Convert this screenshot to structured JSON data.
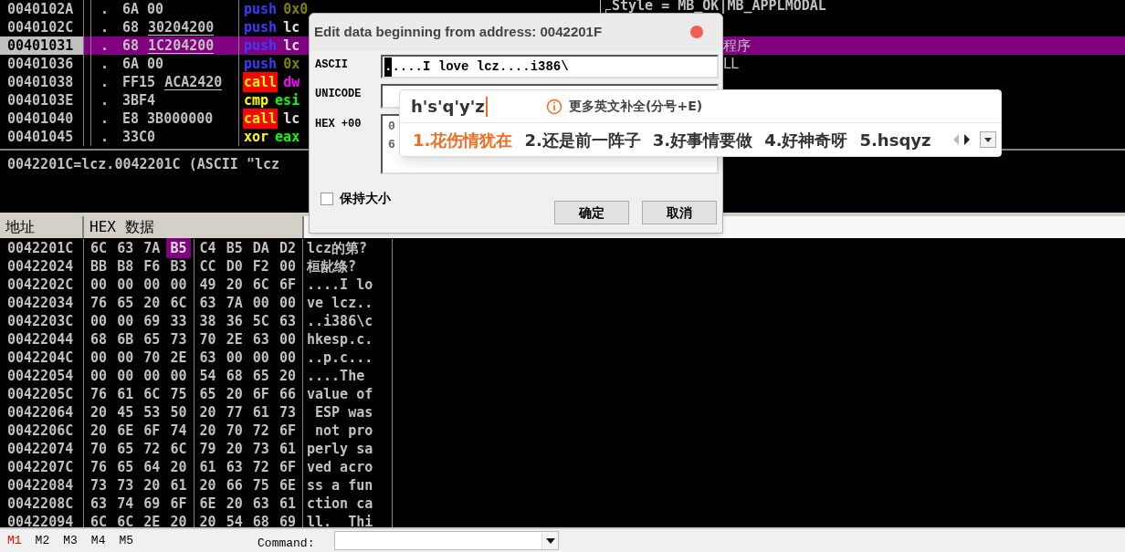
{
  "disassembly": {
    "rows": [
      {
        "address": "0040102A",
        "dot": ".",
        "hex": "6A 00",
        "mnemonic": {
          "text": "push",
          "kind": "push"
        },
        "operand": {
          "text": "0x0",
          "kind": "constant"
        },
        "selected": false,
        "comment": {
          "text": "Style = MB_OK|MB_APPLMODAL",
          "kind": "bracket"
        }
      },
      {
        "address": "0040102C",
        "dot": ".",
        "hex": "68",
        "fixup": "30204200",
        "mnemonic": {
          "text": "push",
          "kind": "push"
        },
        "operand": {
          "text": "lc",
          "kind": "symbol"
        },
        "selected": false
      },
      {
        "address": "00401031",
        "dot": ".",
        "hex": "68",
        "fixup": "1C204200",
        "mnemonic": {
          "text": "push",
          "kind": "push"
        },
        "operand": {
          "text": "lc",
          "kind": "symbol"
        },
        "selected": true,
        "comment": {
          "text": "程序",
          "kind": "plain"
        }
      },
      {
        "address": "00401036",
        "dot": ".",
        "hex": "6A 00",
        "mnemonic": {
          "text": "push",
          "kind": "push"
        },
        "operand": {
          "text": "0x",
          "kind": "constant"
        },
        "selected": false,
        "comment": {
          "text": "LL",
          "kind": "plain"
        }
      },
      {
        "address": "00401038",
        "dot": ".",
        "hex": "FF15",
        "fixup": "ACA2420",
        "mnemonic": {
          "text": "call",
          "kind": "call"
        },
        "operand": {
          "text": "dw",
          "kind": "memory"
        },
        "selected": false
      },
      {
        "address": "0040103E",
        "dot": ".",
        "hex": "3BF4",
        "mnemonic": {
          "text": "cmp",
          "kind": "arith"
        },
        "operand": {
          "text": "esi",
          "kind": "register"
        },
        "selected": false
      },
      {
        "address": "00401040",
        "dot": ".",
        "hex": "E8 3B000000",
        "mnemonic": {
          "text": "call",
          "kind": "call"
        },
        "operand": {
          "text": "lc",
          "kind": "symbol"
        },
        "selected": false
      },
      {
        "address": "00401045",
        "dot": ".",
        "hex": "33C0",
        "mnemonic": {
          "text": "xor",
          "kind": "arith"
        },
        "operand": {
          "text": "eax",
          "kind": "register"
        },
        "selected": false
      }
    ]
  },
  "info": "0042201C=lcz.0042201C (ASCII \"lcz",
  "dump": {
    "columns": [
      "地址",
      "HEX 数据"
    ],
    "rows": [
      {
        "address": "0042201C",
        "bytes": [
          {
            "value": "6C",
            "selected": false
          },
          {
            "value": "63",
            "selected": false
          },
          {
            "value": "7A",
            "selected": false
          },
          {
            "value": "B5",
            "selected": true
          },
          {
            "value": "C4",
            "selected": false
          },
          {
            "value": "B5",
            "selected": false
          },
          {
            "value": "DA",
            "selected": false
          },
          {
            "value": "D2",
            "selected": false
          }
        ],
        "ascii": "lcz的第?"
      },
      {
        "address": "00422024",
        "bytes": [
          {
            "value": "BB",
            "selected": false
          },
          {
            "value": "B8",
            "selected": false
          },
          {
            "value": "F6",
            "selected": false
          },
          {
            "value": "B3",
            "selected": false
          },
          {
            "value": "CC",
            "selected": false
          },
          {
            "value": "D0",
            "selected": false
          },
          {
            "value": "F2",
            "selected": false
          },
          {
            "value": "00",
            "selected": false
          }
        ],
        "ascii": "桓龀绦?"
      },
      {
        "address": "0042202C",
        "bytes": [
          {
            "value": "00",
            "selected": false
          },
          {
            "value": "00",
            "selected": false
          },
          {
            "value": "00",
            "selected": false
          },
          {
            "value": "00",
            "selected": false
          },
          {
            "value": "49",
            "selected": false
          },
          {
            "value": "20",
            "selected": false
          },
          {
            "value": "6C",
            "selected": false
          },
          {
            "value": "6F",
            "selected": false
          }
        ],
        "ascii": "....I lo"
      },
      {
        "address": "00422034",
        "bytes": [
          {
            "value": "76",
            "selected": false
          },
          {
            "value": "65",
            "selected": false
          },
          {
            "value": "20",
            "selected": false
          },
          {
            "value": "6C",
            "selected": false
          },
          {
            "value": "63",
            "selected": false
          },
          {
            "value": "7A",
            "selected": false
          },
          {
            "value": "00",
            "selected": false
          },
          {
            "value": "00",
            "selected": false
          }
        ],
        "ascii": "ve lcz.."
      },
      {
        "address": "0042203C",
        "bytes": [
          {
            "value": "00",
            "selected": false
          },
          {
            "value": "00",
            "selected": false
          },
          {
            "value": "69",
            "selected": false
          },
          {
            "value": "33",
            "selected": false
          },
          {
            "value": "38",
            "selected": false
          },
          {
            "value": "36",
            "selected": false
          },
          {
            "value": "5C",
            "selected": false
          },
          {
            "value": "63",
            "selected": false
          }
        ],
        "ascii": "..i386\\c"
      },
      {
        "address": "00422044",
        "bytes": [
          {
            "value": "68",
            "selected": false
          },
          {
            "value": "6B",
            "selected": false
          },
          {
            "value": "65",
            "selected": false
          },
          {
            "value": "73",
            "selected": false
          },
          {
            "value": "70",
            "selected": false
          },
          {
            "value": "2E",
            "selected": false
          },
          {
            "value": "63",
            "selected": false
          },
          {
            "value": "00",
            "selected": false
          }
        ],
        "ascii": "hkesp.c."
      },
      {
        "address": "0042204C",
        "bytes": [
          {
            "value": "00",
            "selected": false
          },
          {
            "value": "00",
            "selected": false
          },
          {
            "value": "70",
            "selected": false
          },
          {
            "value": "2E",
            "selected": false
          },
          {
            "value": "63",
            "selected": false
          },
          {
            "value": "00",
            "selected": false
          },
          {
            "value": "00",
            "selected": false
          },
          {
            "value": "00",
            "selected": false
          }
        ],
        "ascii": "..p.c..."
      },
      {
        "address": "00422054",
        "bytes": [
          {
            "value": "00",
            "selected": false
          },
          {
            "value": "00",
            "selected": false
          },
          {
            "value": "00",
            "selected": false
          },
          {
            "value": "00",
            "selected": false
          },
          {
            "value": "54",
            "selected": false
          },
          {
            "value": "68",
            "selected": false
          },
          {
            "value": "65",
            "selected": false
          },
          {
            "value": "20",
            "selected": false
          }
        ],
        "ascii": "....The"
      },
      {
        "address": "0042205C",
        "bytes": [
          {
            "value": "76",
            "selected": false
          },
          {
            "value": "61",
            "selected": false
          },
          {
            "value": "6C",
            "selected": false
          },
          {
            "value": "75",
            "selected": false
          },
          {
            "value": "65",
            "selected": false
          },
          {
            "value": "20",
            "selected": false
          },
          {
            "value": "6F",
            "selected": false
          },
          {
            "value": "66",
            "selected": false
          }
        ],
        "ascii": "value of"
      },
      {
        "address": "00422064",
        "bytes": [
          {
            "value": "20",
            "selected": false
          },
          {
            "value": "45",
            "selected": false
          },
          {
            "value": "53",
            "selected": false
          },
          {
            "value": "50",
            "selected": false
          },
          {
            "value": "20",
            "selected": false
          },
          {
            "value": "77",
            "selected": false
          },
          {
            "value": "61",
            "selected": false
          },
          {
            "value": "73",
            "selected": false
          }
        ],
        "ascii": " ESP was"
      },
      {
        "address": "0042206C",
        "bytes": [
          {
            "value": "20",
            "selected": false
          },
          {
            "value": "6E",
            "selected": false
          },
          {
            "value": "6F",
            "selected": false
          },
          {
            "value": "74",
            "selected": false
          },
          {
            "value": "20",
            "selected": false
          },
          {
            "value": "70",
            "selected": false
          },
          {
            "value": "72",
            "selected": false
          },
          {
            "value": "6F",
            "selected": false
          }
        ],
        "ascii": " not pro"
      },
      {
        "address": "00422074",
        "bytes": [
          {
            "value": "70",
            "selected": false
          },
          {
            "value": "65",
            "selected": false
          },
          {
            "value": "72",
            "selected": false
          },
          {
            "value": "6C",
            "selected": false
          },
          {
            "value": "79",
            "selected": false
          },
          {
            "value": "20",
            "selected": false
          },
          {
            "value": "73",
            "selected": false
          },
          {
            "value": "61",
            "selected": false
          }
        ],
        "ascii": "perly sa"
      },
      {
        "address": "0042207C",
        "bytes": [
          {
            "value": "76",
            "selected": false
          },
          {
            "value": "65",
            "selected": false
          },
          {
            "value": "64",
            "selected": false
          },
          {
            "value": "20",
            "selected": false
          },
          {
            "value": "61",
            "selected": false
          },
          {
            "value": "63",
            "selected": false
          },
          {
            "value": "72",
            "selected": false
          },
          {
            "value": "6F",
            "selected": false
          }
        ],
        "ascii": "ved acro"
      },
      {
        "address": "00422084",
        "bytes": [
          {
            "value": "73",
            "selected": false
          },
          {
            "value": "73",
            "selected": false
          },
          {
            "value": "20",
            "selected": false
          },
          {
            "value": "61",
            "selected": false
          },
          {
            "value": "20",
            "selected": false
          },
          {
            "value": "66",
            "selected": false
          },
          {
            "value": "75",
            "selected": false
          },
          {
            "value": "6E",
            "selected": false
          }
        ],
        "ascii": "ss a fun"
      },
      {
        "address": "0042208C",
        "bytes": [
          {
            "value": "63",
            "selected": false
          },
          {
            "value": "74",
            "selected": false
          },
          {
            "value": "69",
            "selected": false
          },
          {
            "value": "6F",
            "selected": false
          },
          {
            "value": "6E",
            "selected": false
          },
          {
            "value": "20",
            "selected": false
          },
          {
            "value": "63",
            "selected": false
          },
          {
            "value": "61",
            "selected": false
          }
        ],
        "ascii": "ction ca"
      },
      {
        "address": "00422094",
        "bytes": [
          {
            "value": "6C",
            "selected": false
          },
          {
            "value": "6C",
            "selected": false
          },
          {
            "value": "2E",
            "selected": false
          },
          {
            "value": "20",
            "selected": false
          },
          {
            "value": "20",
            "selected": false
          },
          {
            "value": "54",
            "selected": false
          },
          {
            "value": "68",
            "selected": false
          },
          {
            "value": "69",
            "selected": false
          }
        ],
        "ascii": "ll.  Thi"
      }
    ]
  },
  "status_bar": {
    "bookmarks": [
      {
        "label": "M1",
        "selected": true
      },
      {
        "label": "M2",
        "selected": false
      },
      {
        "label": "M3",
        "selected": false
      },
      {
        "label": "M4",
        "selected": false
      },
      {
        "label": "M5",
        "selected": false
      }
    ],
    "command_label": "Command:"
  },
  "dialog": {
    "title": "Edit data beginning from address: 0042201F",
    "ascii": {
      "label": "ASCII",
      "selected_text": ".",
      "value": "....I love lcz....i386\\"
    },
    "unicode": {
      "label": "UNICODE"
    },
    "hex": {
      "label": "HEX +00",
      "lines": [
        "0",
        "6"
      ]
    },
    "keep_size": {
      "label": "保持大小",
      "checked": false
    },
    "buttons": [
      "确定",
      "取消"
    ]
  },
  "ime": {
    "composition": "h's'q'y'z",
    "hint": "更多英文补全(分号+E)",
    "candidates": [
      {
        "text": "1.花伤情犹在",
        "selected": true
      },
      {
        "text": "2.还是前一阵子",
        "selected": false
      },
      {
        "text": "3.好事情要做",
        "selected": false
      },
      {
        "text": "4.好神奇呀",
        "selected": false
      },
      {
        "text": "5.hsqyz",
        "selected": false
      }
    ],
    "prev_page": {
      "disabled": true
    },
    "next_page": {
      "disabled": false
    }
  }
}
